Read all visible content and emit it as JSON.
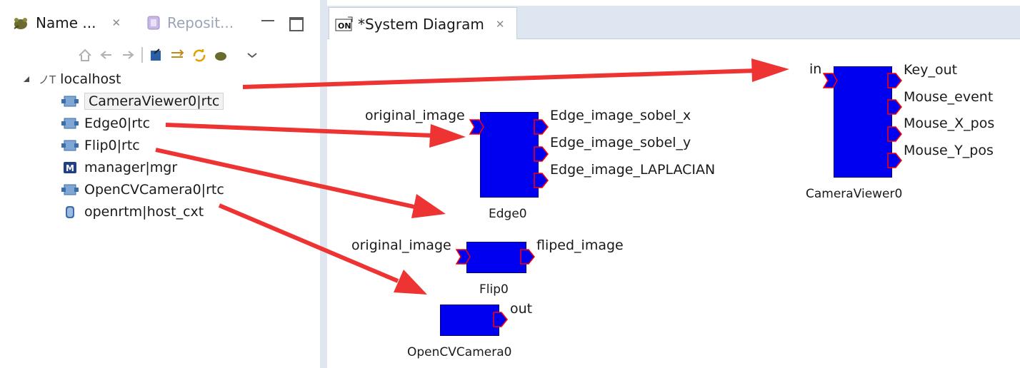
{
  "left_view": {
    "tabs": [
      {
        "label": "Name ..."
      },
      {
        "label": "Reposit..."
      }
    ],
    "tree": {
      "root": {
        "prefix": "ノT",
        "label": "localhost"
      },
      "items": [
        {
          "label": "CameraViewer0|rtc",
          "icon": "rtc-component-icon"
        },
        {
          "label": "Edge0|rtc",
          "icon": "rtc-component-icon"
        },
        {
          "label": "Flip0|rtc",
          "icon": "rtc-component-icon"
        },
        {
          "label": "manager|mgr",
          "icon": "manager-icon"
        },
        {
          "label": "OpenCVCamera0|rtc",
          "icon": "rtc-component-icon"
        },
        {
          "label": "openrtm|host_cxt",
          "icon": "host-context-icon"
        }
      ]
    }
  },
  "right_view": {
    "tab": {
      "label": "*System Diagram"
    },
    "components": {
      "camera_viewer": {
        "name": "CameraViewer0",
        "in_ports": [
          "in"
        ],
        "out_ports": [
          "Key_out",
          "Mouse_event",
          "Mouse_X_pos",
          "Mouse_Y_pos"
        ]
      },
      "edge": {
        "name": "Edge0",
        "in_ports": [
          "original_image"
        ],
        "out_ports": [
          "Edge_image_sobel_x",
          "Edge_image_sobel_y",
          "Edge_image_LAPLACIAN"
        ]
      },
      "flip": {
        "name": "Flip0",
        "in_ports": [
          "original_image"
        ],
        "out_ports": [
          "fliped_image"
        ]
      },
      "camera": {
        "name": "OpenCVCamera0",
        "out_ports": [
          "out"
        ]
      }
    }
  },
  "colors": {
    "component_fill": "#0000f0",
    "port_fill": "#0000f0",
    "port_border": "#ff0000",
    "annotation_arrow": "#ee3333",
    "tabstrip": "#dde6f1"
  }
}
